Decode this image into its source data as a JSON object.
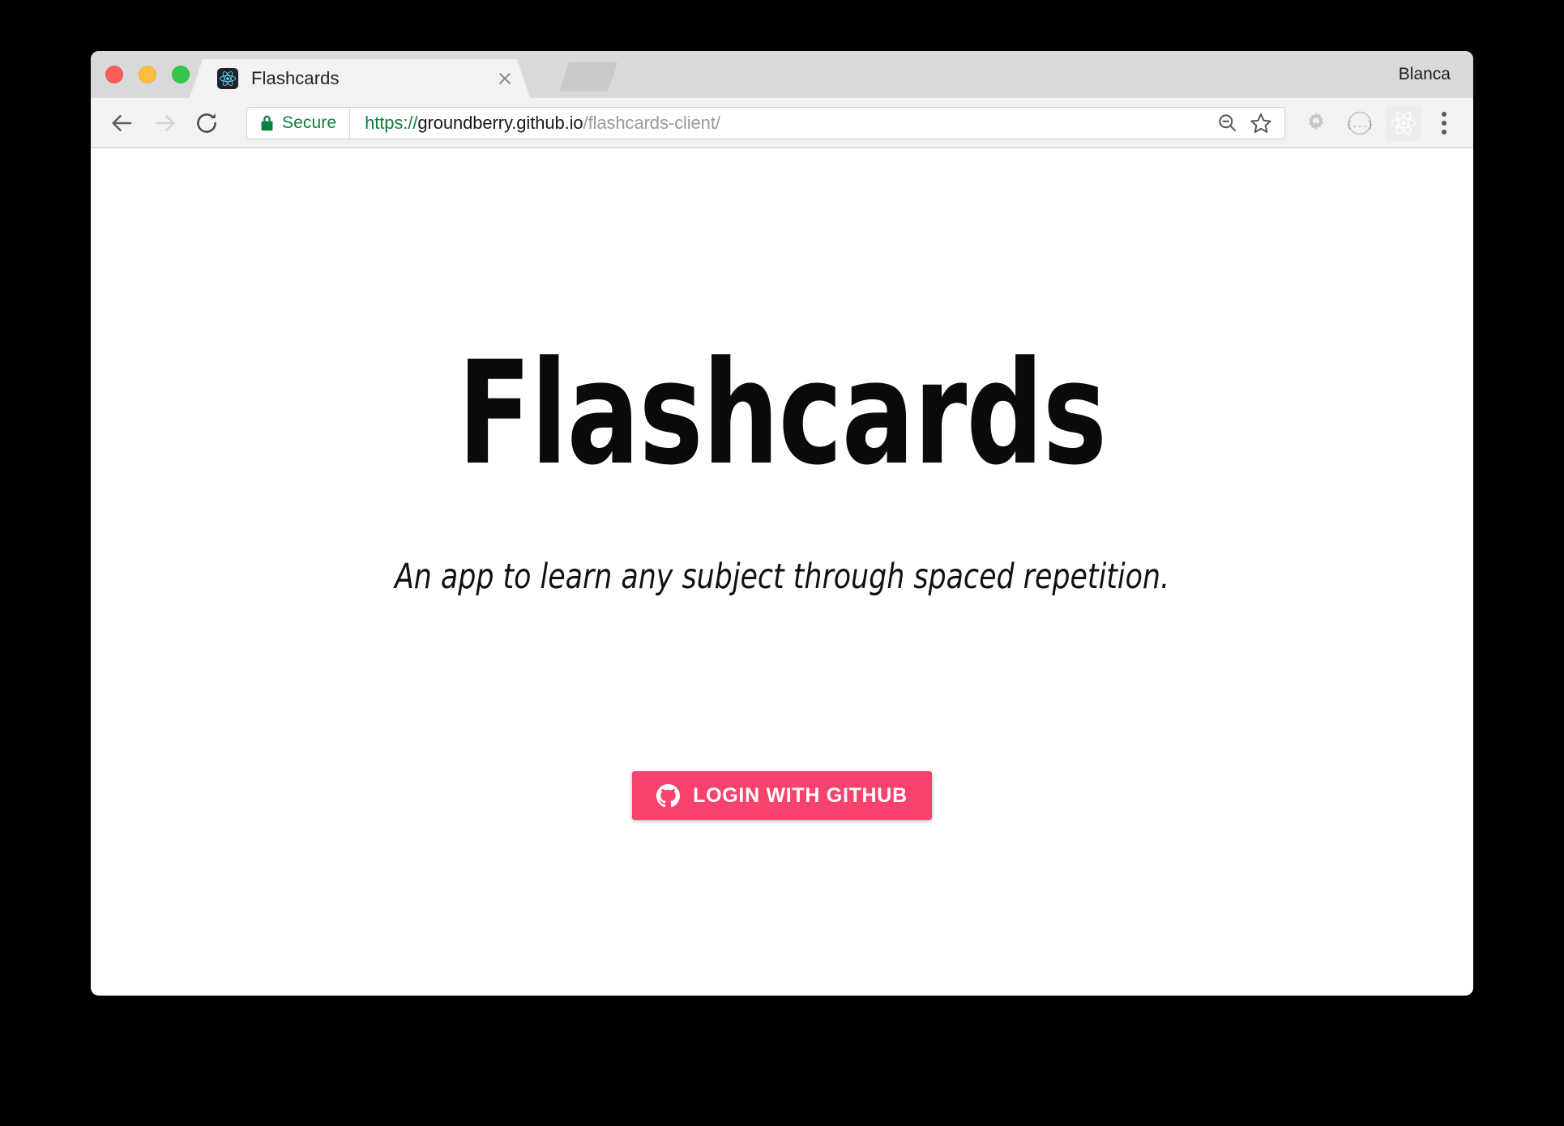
{
  "window": {
    "profile_name": "Blanca"
  },
  "tabs": [
    {
      "title": "Flashcards",
      "favicon": "react-logo-icon",
      "close_icon": "close-icon",
      "active": true
    }
  ],
  "new_tab": {
    "icon": "new-tab-icon",
    "label": ""
  },
  "toolbar": {
    "back_icon": "back-arrow-icon",
    "forward_icon": "forward-arrow-icon",
    "reload_icon": "reload-icon",
    "omnibox": {
      "security_icon": "lock-icon",
      "security_label": "Secure",
      "url_scheme": "https://",
      "url_host": "groundberry.github.io",
      "url_path": "/flashcards-client/",
      "full_url": "https://groundberry.github.io/flashcards-client/",
      "zoom_out_icon": "zoom-out-icon",
      "bookmark_icon": "star-icon"
    },
    "extensions": [
      {
        "icon": "gear-extension-icon",
        "name": "gear-extension"
      },
      {
        "icon": "braces-circle-icon",
        "name": "json-viewer-extension"
      },
      {
        "icon": "react-devtools-icon",
        "name": "react-devtools-extension"
      }
    ],
    "menu_icon": "three-dot-menu-icon"
  },
  "page": {
    "title": "Flashcards",
    "tagline": "An app to learn any subject through spaced repetition.",
    "login_button": {
      "label": "LOGIN WITH GITHUB",
      "icon": "github-icon",
      "background_color": "#f9436e",
      "text_color": "#ffffff"
    }
  },
  "colors": {
    "accent_pink": "#f9436e",
    "secure_green": "#0c8040",
    "traffic_red": "#fb5d58",
    "traffic_yellow": "#fdbc40",
    "traffic_green": "#34c749",
    "tab_strip_bg": "#d9d9d9",
    "toolbar_bg": "#f2f2f2",
    "page_bg": "#ffffff",
    "desktop_bg": "#000000"
  }
}
